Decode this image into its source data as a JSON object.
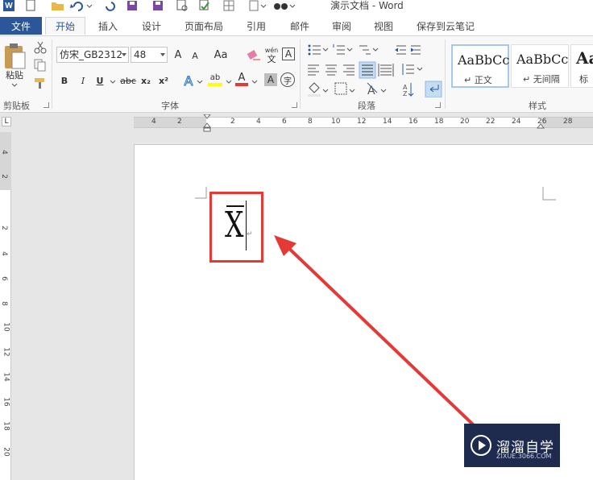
{
  "window": {
    "title": "演示文档 - Word",
    "app_logo": "W"
  },
  "tabs": {
    "file": "文件",
    "items": [
      "开始",
      "插入",
      "设计",
      "页面布局",
      "引用",
      "邮件",
      "审阅",
      "视图",
      "保存到云笔记"
    ],
    "active": "开始"
  },
  "ribbon": {
    "clipboard": {
      "paste_label": "粘贴",
      "group_label": "剪贴板"
    },
    "font": {
      "font_name": "仿宋_GB2312",
      "font_size": "48",
      "grow": "A",
      "shrink": "A",
      "case": "Aa",
      "phonetic": "wén",
      "phonetic_sub": "文",
      "border_char": "A",
      "bold": "B",
      "italic": "I",
      "underline": "U",
      "strike": "abc",
      "subscript": "x₂",
      "superscript": "x²",
      "effects": "A",
      "highlight": "ab",
      "font_color": "A",
      "shading": "A",
      "enclose": "字",
      "group_label": "字体"
    },
    "paragraph": {
      "group_label": "段落"
    },
    "styles": {
      "group_label": "样式",
      "items": [
        {
          "sample": "AaBbCc",
          "name": "↵ 正文"
        },
        {
          "sample": "AaBbCc",
          "name": "↵ 无间隔"
        },
        {
          "sample": "Aa",
          "name": "标"
        }
      ]
    }
  },
  "ruler": {
    "corner": "L",
    "h_labels": [
      "4",
      "2",
      "2",
      "4",
      "6",
      "8",
      "10",
      "12",
      "14",
      "16",
      "18",
      "20",
      "22",
      "24",
      "26",
      "28"
    ],
    "v_labels": [
      "4",
      "2",
      "2",
      "4",
      "6",
      "8",
      "10",
      "12",
      "14",
      "16",
      "18",
      "20"
    ]
  },
  "document": {
    "content": "X",
    "para_mark": "↵"
  },
  "watermark": {
    "text": "溜溜自学",
    "sub": "ZIXUE.3066.COM"
  },
  "colors": {
    "accent": "#2b579a",
    "annotation_red": "#e53935"
  }
}
